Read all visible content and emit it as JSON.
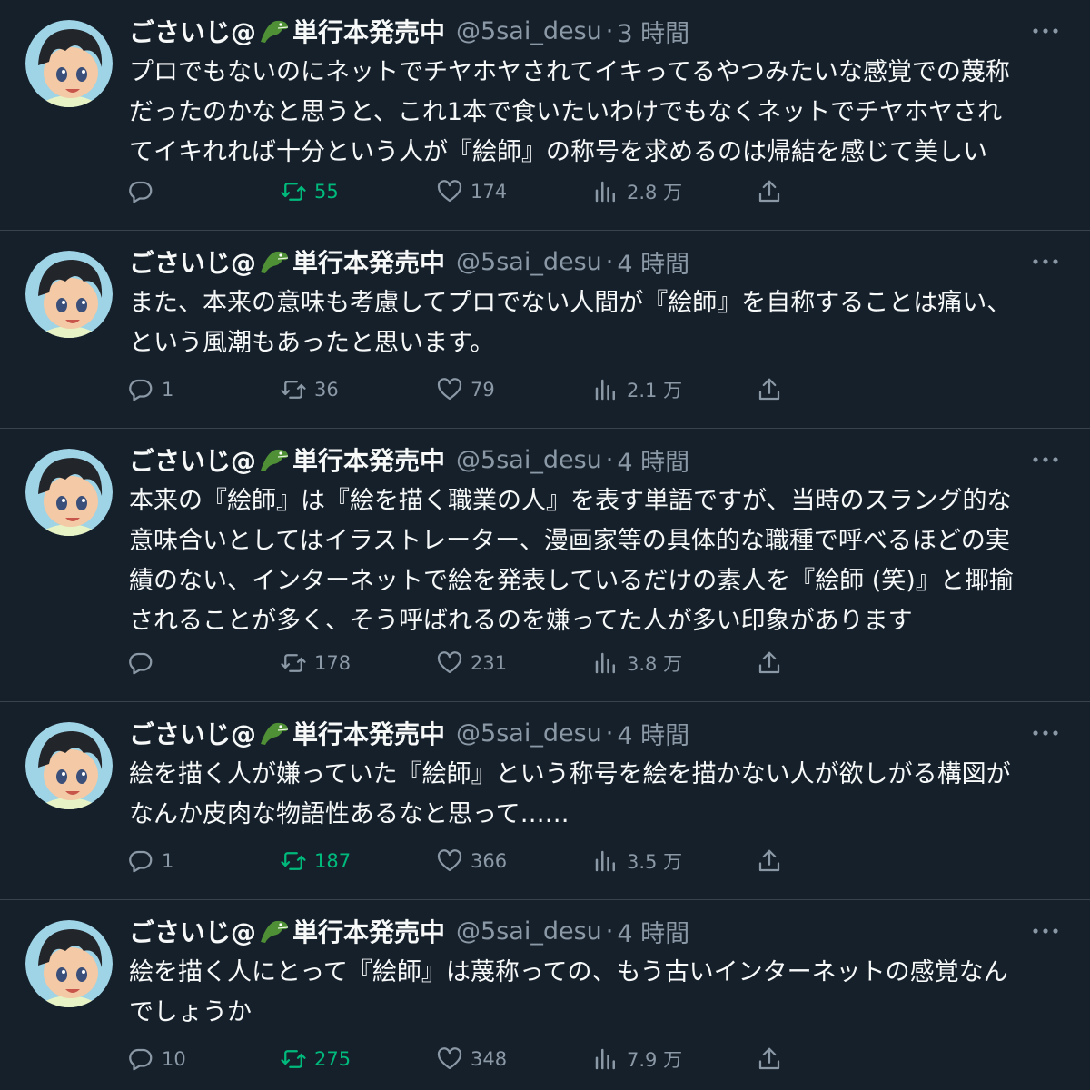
{
  "colors": {
    "background": "#15202b",
    "divider": "#38444d",
    "text": "#f7f9f9",
    "muted": "#8b98a5",
    "retweet_active": "#00ba7c"
  },
  "icons": [
    "reply-icon",
    "retweet-icon",
    "like-icon",
    "views-icon",
    "share-icon",
    "more-icon",
    "crocodile-emoji-icon",
    "avatar"
  ],
  "tweets": [
    {
      "display_name": "ごさいじ@",
      "display_name_suffix": "単行本発売中",
      "handle": "@5sai_desu",
      "separator": "·",
      "time": "3 時間",
      "lines": [
        "プロでもないのにネットでチヤホヤされてイキってるやつみたいな感覚での蔑称",
        "だったのかなと思うと、これ1本で食いたいわけでもなくネットでチヤホヤされ",
        "てイキれれば十分という人が『絵師』の称号を求めるのは帰結を感じて美しい"
      ],
      "replies": "",
      "retweets": "55",
      "retweeted": true,
      "likes": "174",
      "views": "2.8 万"
    },
    {
      "display_name": "ごさいじ@",
      "display_name_suffix": "単行本発売中",
      "handle": "@5sai_desu",
      "separator": "·",
      "time": "4 時間",
      "lines": [
        "また、本来の意味も考慮してプロでない人間が『絵師』を自称することは痛い、",
        "という風潮もあったと思います。"
      ],
      "replies": "1",
      "retweets": "36",
      "retweeted": false,
      "likes": "79",
      "views": "2.1 万"
    },
    {
      "display_name": "ごさいじ@",
      "display_name_suffix": "単行本発売中",
      "handle": "@5sai_desu",
      "separator": "·",
      "time": "4 時間",
      "lines": [
        "本来の『絵師』は『絵を描く職業の人』を表す単語ですが、当時のスラング的な",
        "意味合いとしてはイラストレーター、漫画家等の具体的な職種で呼べるほどの実",
        "績のない、インターネットで絵を発表しているだけの素人を『絵師 (笑)』と揶揄",
        "されることが多く、そう呼ばれるのを嫌ってた人が多い印象があります"
      ],
      "replies": "",
      "retweets": "178",
      "retweeted": false,
      "likes": "231",
      "views": "3.8 万"
    },
    {
      "display_name": "ごさいじ@",
      "display_name_suffix": "単行本発売中",
      "handle": "@5sai_desu",
      "separator": "·",
      "time": "4 時間",
      "lines": [
        "絵を描く人が嫌っていた『絵師』という称号を絵を描かない人が欲しがる構図が",
        "なんか皮肉な物語性あるなと思って……"
      ],
      "replies": "1",
      "retweets": "187",
      "retweeted": true,
      "likes": "366",
      "views": "3.5 万"
    },
    {
      "display_name": "ごさいじ@",
      "display_name_suffix": "単行本発売中",
      "handle": "@5sai_desu",
      "separator": "·",
      "time": "4 時間",
      "lines": [
        "絵を描く人にとって『絵師』は蔑称っての、もう古いインターネットの感覚なん",
        "でしょうか"
      ],
      "replies": "10",
      "retweets": "275",
      "retweeted": true,
      "likes": "348",
      "views": "7.9 万"
    }
  ]
}
